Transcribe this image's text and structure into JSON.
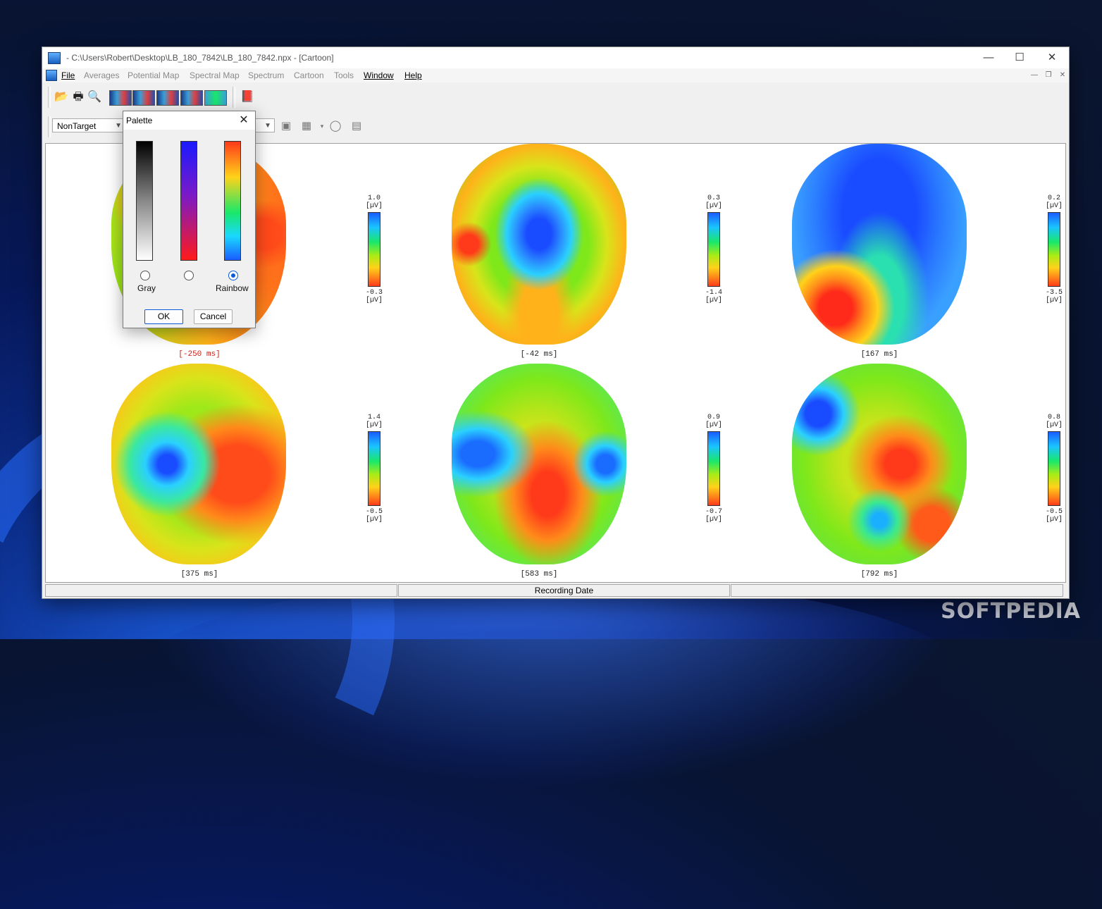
{
  "window": {
    "title": "- C:\\Users\\Robert\\Desktop\\LB_180_7842\\LB_180_7842.npx - [Cartoon]"
  },
  "menu": {
    "items": [
      "File",
      "Averages",
      "Potential Map",
      "Spectral Map",
      "Spectrum",
      "Cartoon",
      "Tools",
      "Window",
      "Help"
    ]
  },
  "toolbar": {
    "condition_value": "NonTarget"
  },
  "maps": [
    {
      "time": "[-250 ms]",
      "max": "1.0",
      "min": "-0.3",
      "unit": "[µV]"
    },
    {
      "time": "[-42 ms]",
      "max": "0.3",
      "min": "-1.4",
      "unit": "[µV]"
    },
    {
      "time": "[167 ms]",
      "max": "0.2",
      "min": "-3.5",
      "unit": "[µV]"
    },
    {
      "time": "[375 ms]",
      "max": "1.4",
      "min": "-0.5",
      "unit": "[µV]"
    },
    {
      "time": "[583 ms]",
      "max": "0.9",
      "min": "-0.7",
      "unit": "[µV]"
    },
    {
      "time": "[792 ms]",
      "max": "0.8",
      "min": "-0.5",
      "unit": "[µV]"
    }
  ],
  "status": {
    "recording_date": "Recording Date"
  },
  "palette_dialog": {
    "title": "Palette",
    "options": [
      "Gray",
      "",
      "Rainbow"
    ],
    "selected": "Rainbow",
    "ok": "OK",
    "cancel": "Cancel"
  },
  "watermark": "SOFTPEDIA",
  "colors": {
    "accent": "#0a5ad8",
    "red_label": "#c8201a"
  }
}
